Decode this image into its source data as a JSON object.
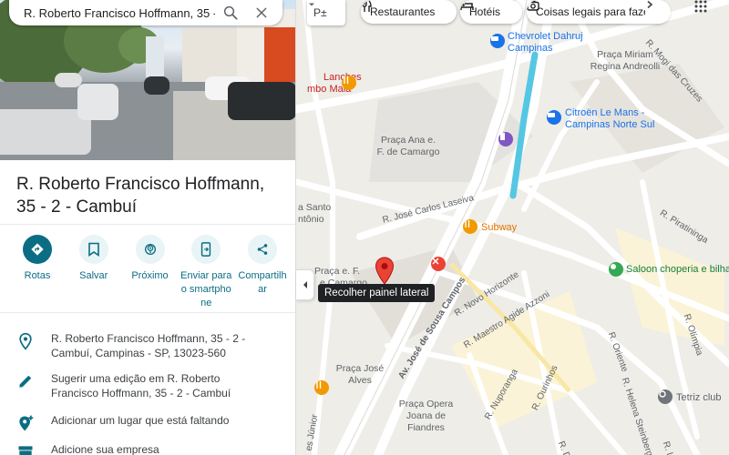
{
  "search": {
    "value": "R. Roberto Francisco Hoffmann, 35 - 2 - Cambuí",
    "search_icon": "search-icon",
    "close_icon": "close-icon"
  },
  "place": {
    "title": "R. Roberto Francisco Hoffmann, 35 - 2 - Cambuí"
  },
  "actions": [
    {
      "label": "Rotas",
      "icon": "directions-icon"
    },
    {
      "label": "Salvar",
      "icon": "bookmark-icon"
    },
    {
      "label": "Próximo",
      "icon": "nearby-icon"
    },
    {
      "label": "Enviar para o smartphone",
      "icon": "send-to-phone-icon"
    },
    {
      "label": "Compartilhar",
      "icon": "share-icon"
    }
  ],
  "info": {
    "address": "R. Roberto Francisco Hoffmann, 35 - 2 - Cambuí, Campinas - SP, 13023-560",
    "suggest_edit": "Sugerir uma edição em R. Roberto Francisco Hoffmann, 35 - 2 - Cambuí",
    "add_place": "Adicionar um lugar que está faltando",
    "add_business": "Adicione sua empresa"
  },
  "chips": [
    {
      "label": "Restaurantes",
      "icon": "restaurant-icon"
    },
    {
      "label": "Hotéis",
      "icon": "hotel-icon"
    },
    {
      "label": "Coisas legais para fazer",
      "icon": "camera-icon"
    }
  ],
  "map": {
    "layers_label": "P±",
    "tooltip": "Recolher painel lateral",
    "places": {
      "chevrolet": "Chevrolet Dahruj Campinas",
      "praca_miriam": "Praça Miriam Regina Andreolli",
      "lanches": "Lanches",
      "lanches_b": "mbo Maia",
      "citroen": "Citroën Le Mans - Campinas Norte Sul",
      "praca_ana": "Praça Ana e. F. de Camargo",
      "santo": "a Santo",
      "antonio": "ntônio",
      "subway": "Subway",
      "praca_e": "Praça e. F.",
      "camargo2": "e Camargo",
      "saloon": "Saloon choperia e bilha",
      "praca_jose": "Praça José Alves",
      "praca_opera": "Praça Opera Joana de Fiandres",
      "tetriz": "Tetriz club"
    },
    "streets": {
      "mogi": "R. Mogi das Cruzes",
      "laseiva": "R. José Carlos Laseiva",
      "piratininga": "R. Piratininga",
      "av_jose": "Av. José de Sousa Campos",
      "novo_horizonte": "R. Novo Horizonte",
      "maestro": "R. Maestro Agide Azzoni",
      "oriente": "R. Oriente",
      "helena": "R. Helena Steinberg",
      "olimpia": "R. Olímpia",
      "nuporanga": "R. Nuporanga",
      "ourinhos": "R. Ourinhos",
      "dom": "R. Dom",
      "junior": "es Júnior",
      "luzi": "R. Luzi"
    }
  },
  "colors": {
    "accent": "#0b6d83",
    "accent_light": "#e8f4f6",
    "marker": "#ea4335",
    "poi_orange": "#f29900",
    "poi_blue": "#1a73e8",
    "poi_green": "#34a853",
    "poi_gray": "#70757a",
    "canal": "#55c7e3"
  }
}
